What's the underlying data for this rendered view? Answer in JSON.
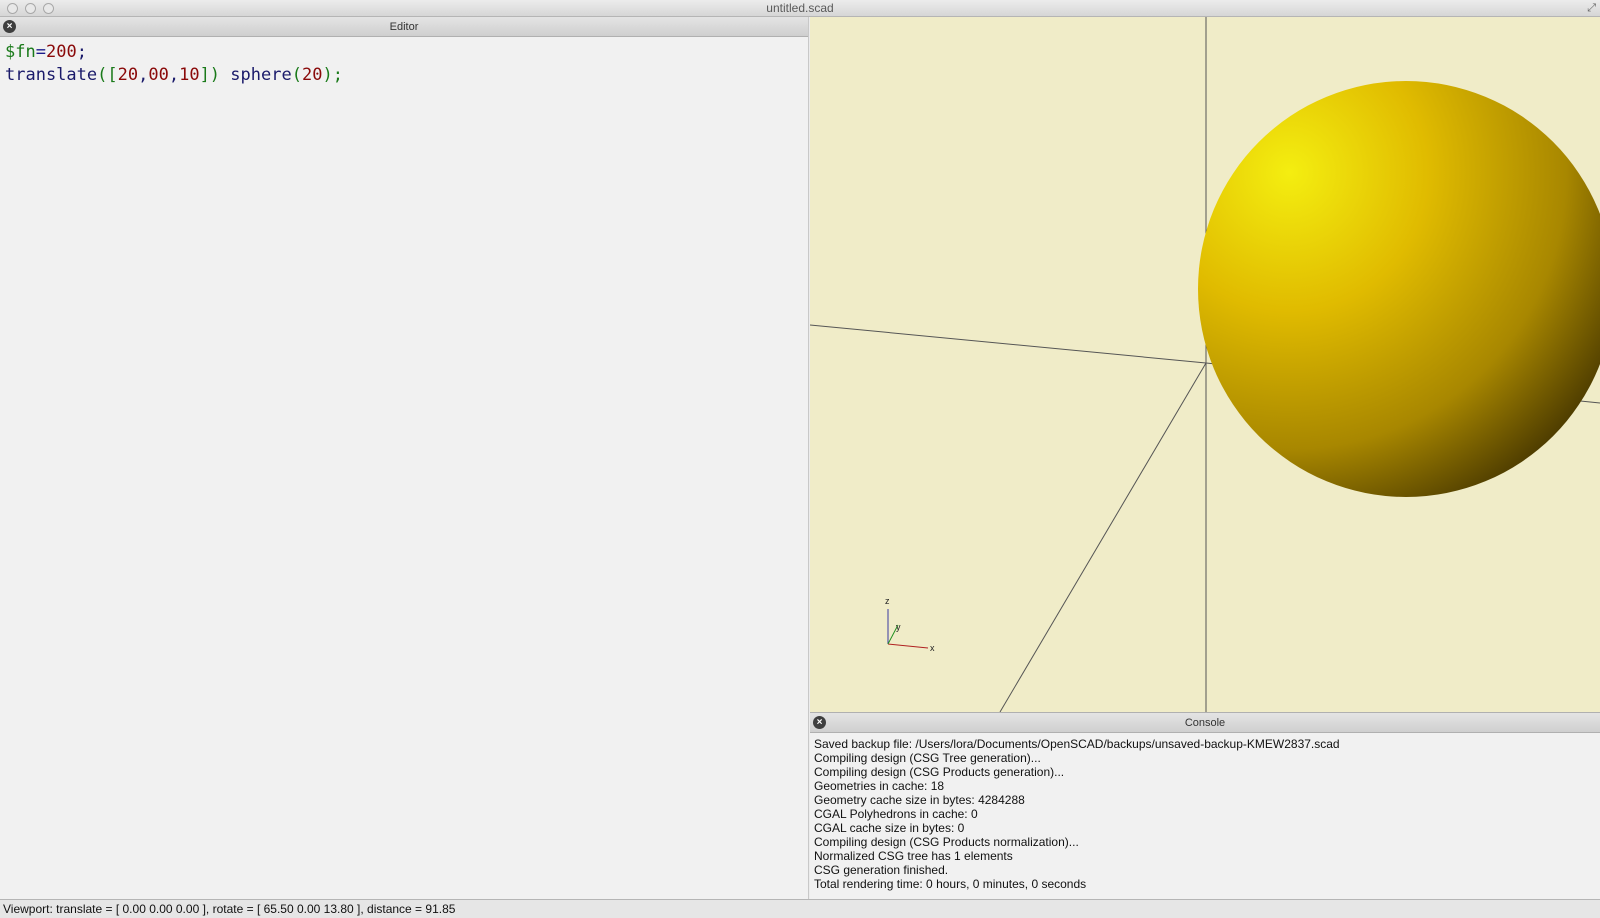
{
  "window": {
    "title": "untitled.scad"
  },
  "editor": {
    "title": "Editor",
    "code": {
      "line1": {
        "var": "$fn",
        "op": "=",
        "num": "200",
        "end": ";"
      },
      "line2": {
        "fn1": "translate",
        "open": "([",
        "n1": "20",
        "c1": ",",
        "n2": "00",
        "c2": ",",
        "n3": "10",
        "close": "])",
        "fn2": "sphere",
        "open2": "(",
        "n4": "20",
        "close2": ");"
      }
    }
  },
  "viewport": {
    "background": "#f0ecc8",
    "sphere_color": "#e6c800",
    "axes_labels": {
      "z": "z",
      "y": "y",
      "x": "x"
    }
  },
  "console": {
    "title": "Console",
    "lines": [
      "Saved backup file: /Users/lora/Documents/OpenSCAD/backups/unsaved-backup-KMEW2837.scad",
      "Compiling design (CSG Tree generation)...",
      "Compiling design (CSG Products generation)...",
      "Geometries in cache: 18",
      "Geometry cache size in bytes: 4284288",
      "CGAL Polyhedrons in cache: 0",
      "CGAL cache size in bytes: 0",
      "Compiling design (CSG Products normalization)...",
      "Normalized CSG tree has 1 elements",
      "CSG generation finished.",
      "Total rendering time: 0 hours, 0 minutes, 0 seconds"
    ]
  },
  "status": {
    "text": "Viewport: translate = [ 0.00 0.00 0.00 ], rotate = [ 65.50 0.00 13.80 ], distance = 91.85"
  }
}
